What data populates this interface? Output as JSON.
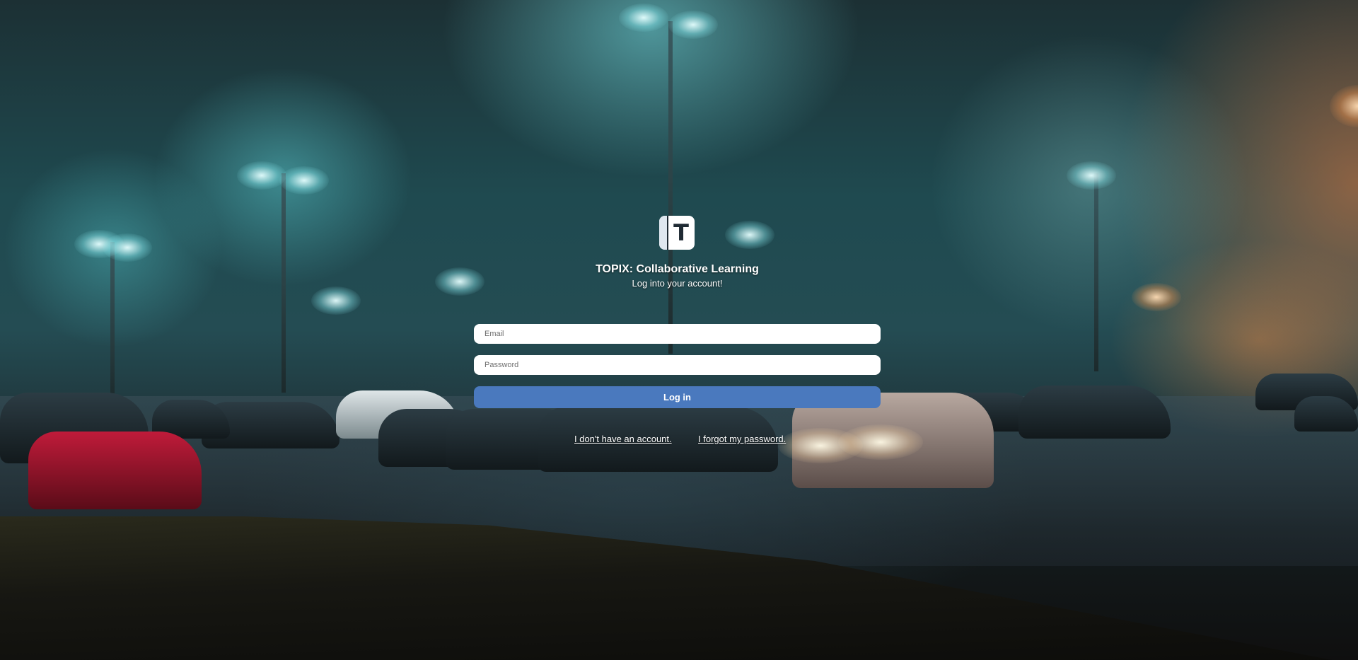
{
  "app": {
    "title": "TOPIX: Collaborative Learning",
    "subtitle": "Log into your account!",
    "logo_letter": "T",
    "logo_icon": "topix-logo-icon"
  },
  "form": {
    "email_placeholder": "Email",
    "email_value": "",
    "password_placeholder": "Password",
    "password_value": "",
    "login_label": "Log in",
    "login_button_color": "#4a79be"
  },
  "links": {
    "signup": "I don't have an account.",
    "forgot": "I forgot my password."
  }
}
